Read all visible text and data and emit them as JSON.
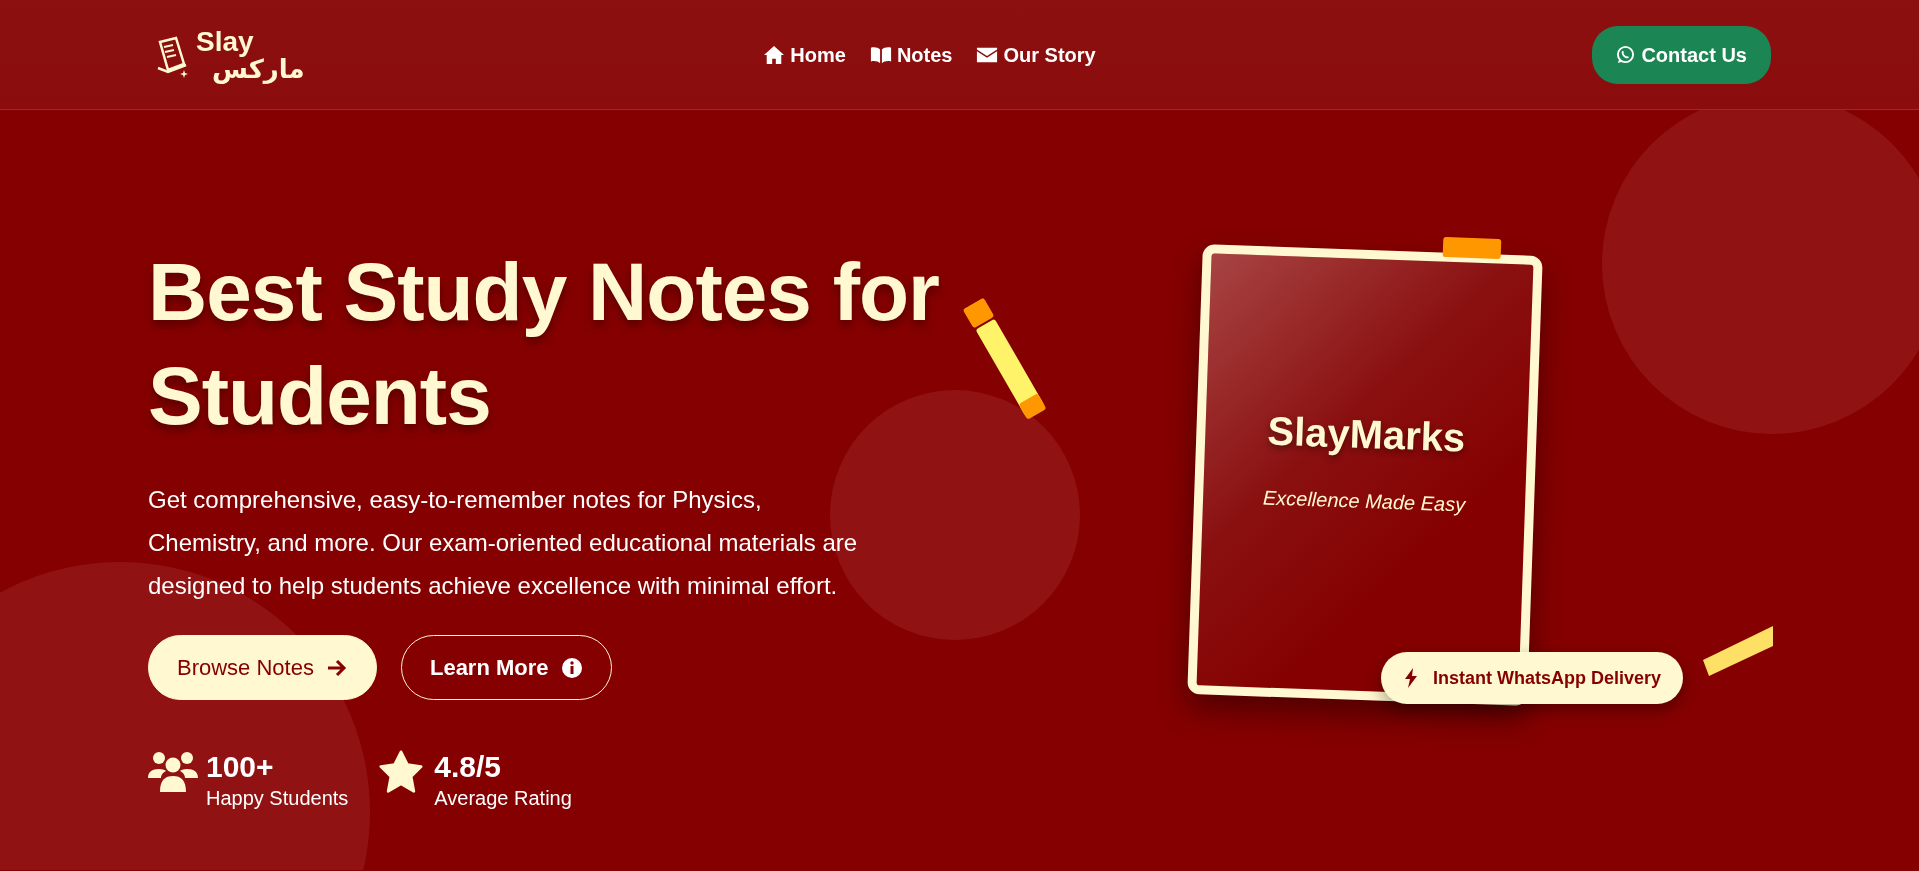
{
  "navbar": {
    "logo": {
      "latin": "Slay",
      "arabic": "ماركس"
    },
    "links": [
      {
        "label": "Home"
      },
      {
        "label": "Notes"
      },
      {
        "label": "Our Story"
      }
    ],
    "contact_button": {
      "label": "Contact Us"
    }
  },
  "hero": {
    "title": "Best Study Notes for Students",
    "description": "Get comprehensive, easy-to-remember notes for Physics, Chemistry, and more. Our exam-oriented educational materials are designed to help students achieve excellence with minimal effort.",
    "buttons": [
      {
        "label": "Browse Notes",
        "kind": "primary"
      },
      {
        "label": "Learn More",
        "kind": "outline"
      }
    ],
    "stats": [
      {
        "value": "100+",
        "label": "Happy Students"
      },
      {
        "value": "4.8/5",
        "label": "Average Rating"
      }
    ]
  },
  "book": {
    "title": "SlayMarks",
    "subtitle": "Excellence Made Easy",
    "badge": {
      "label": "Instant WhatsApp Delivery"
    }
  }
}
